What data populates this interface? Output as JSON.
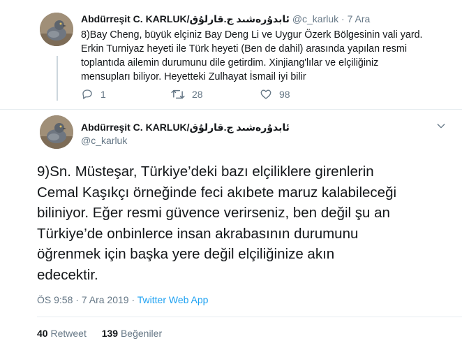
{
  "tweet1": {
    "author_name": "Abdürreşit C. KARLUK/ئابدۇرەشىد ج.قارلۇق",
    "handle": "@c_karluk",
    "date": "7 Ara",
    "separator": "·",
    "body_lines": [
      "8)Bay Cheng, büyük elçiniz Bay Deng Li ve Uygur Özerk Bölgesinin vali yard.",
      "Erkin Turniyaz heyeti ile Türk heyeti (Ben de dahil) arasında yapılan resmi",
      "toplantıda ailemin durumunu dile getirdim. Xinjiang'lılar ve elçiliğiniz",
      "mensupları biliyor. Heyetteki Zulhayat İsmail iyi bilir"
    ],
    "reply_count": "1",
    "retweet_count": "28",
    "like_count": "98"
  },
  "tweet2": {
    "author_name": "Abdürreşit C. KARLUK/ئابدۇرەشىد ج.قارلۇق",
    "handle": "@c_karluk",
    "body_lines": [
      "9)Sn. Müsteşar, Türkiye’deki bazı elçiliklere girenlerin",
      "Cemal Kaşıkçı örneğinde feci akıbete maruz kalabileceği",
      "biliniyor. Eğer resmi güvence verirseniz, ben değil şu an",
      "Türkiye’de onbinlerce insan akrabasının durumunu",
      "öğrenmek için başka yere değil elçiliğinize akın",
      "edecektir."
    ],
    "time": "ÖS 9:58",
    "date": "7 Ara 2019",
    "separator": "·",
    "source": "Twitter Web App",
    "retweets_value": "40",
    "retweets_label": "Retweet",
    "likes_value": "139",
    "likes_label": "Beğeniler"
  },
  "icons": [
    "reply-icon",
    "retweet-icon",
    "like-icon",
    "chevron-down-icon"
  ],
  "colors": {
    "text": "#14171a",
    "secondary": "#657786",
    "link": "#1da1f2",
    "divider": "#e6ecf0"
  }
}
